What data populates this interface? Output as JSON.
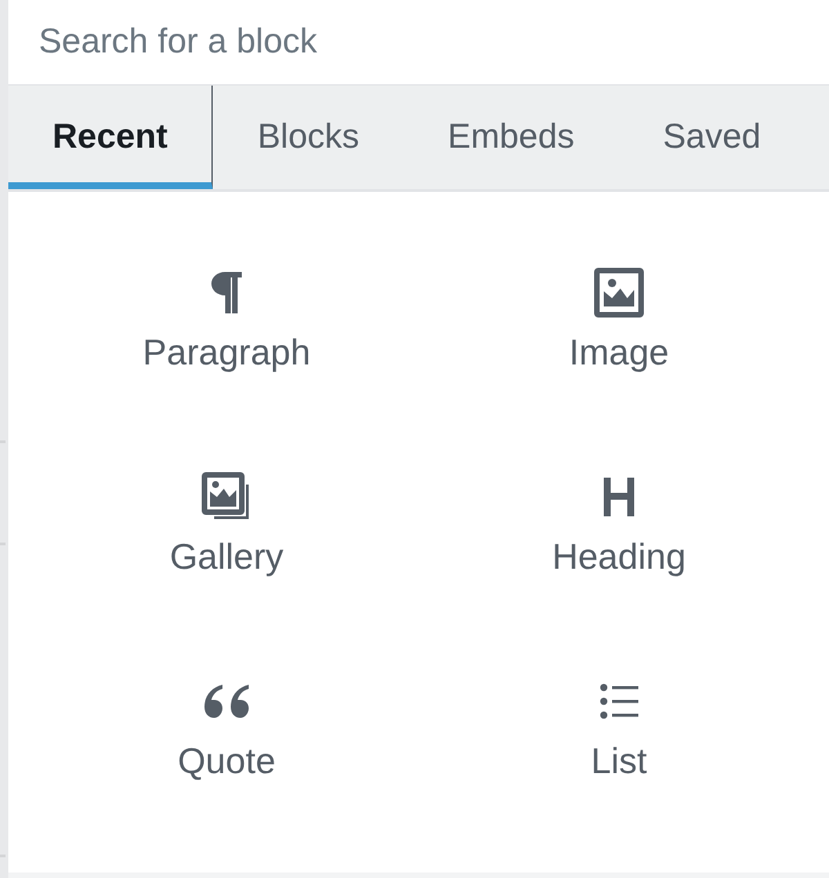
{
  "search": {
    "placeholder": "Search for a block"
  },
  "tabs": [
    {
      "label": "Recent",
      "selected": true
    },
    {
      "label": "Blocks",
      "selected": false
    },
    {
      "label": "Embeds",
      "selected": false
    },
    {
      "label": "Saved",
      "selected": false
    }
  ],
  "blocks": [
    {
      "label": "Paragraph",
      "kind": "paragraph"
    },
    {
      "label": "Image",
      "kind": "image"
    },
    {
      "label": "Gallery",
      "kind": "gallery"
    },
    {
      "label": "Heading",
      "kind": "heading"
    },
    {
      "label": "Quote",
      "kind": "quote"
    },
    {
      "label": "List",
      "kind": "list"
    }
  ]
}
